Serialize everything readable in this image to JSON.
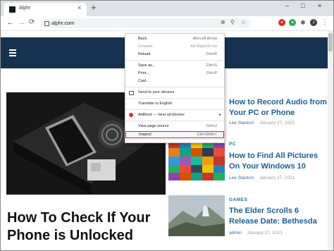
{
  "browser": {
    "tab_title": "Alphr",
    "tab_close": "×",
    "new_tab": "+",
    "url": "alphr.com",
    "back_glyph": "←",
    "forward_glyph": "→",
    "reload_glyph": "C",
    "window_buttons": [
      "–",
      "□",
      "×"
    ]
  },
  "context_menu": {
    "items": [
      {
        "label": "Back",
        "shortcut": "Alt+Left Arrow"
      },
      {
        "label": "Forward",
        "shortcut": "Alt+Right Arrow",
        "disabled": true
      },
      {
        "label": "Reload",
        "shortcut": "Ctrl+R"
      },
      {
        "label": "Save as...",
        "shortcut": "Ctrl+S"
      },
      {
        "label": "Print...",
        "shortcut": "Ctrl+P"
      },
      {
        "label": "Cast...",
        "shortcut": ""
      },
      {
        "label": "Send to your devices",
        "shortcut": ""
      },
      {
        "label": "Translate to English",
        "shortcut": ""
      },
      {
        "label": "AdBlock — best ad blocker",
        "shortcut": ""
      },
      {
        "label": "View page source",
        "shortcut": "Ctrl+U"
      },
      {
        "label": "Inspect",
        "shortcut": "Ctrl+Shift+I"
      }
    ]
  },
  "page": {
    "featured_title": "How To Check If Your Phone is Unlocked",
    "articles": [
      {
        "category": "",
        "title": "How to Record Audio from Your PC or Phone",
        "author": "Lee Stanton",
        "date": "January 27, 2021"
      },
      {
        "category": "PC",
        "title": "How to Find All Pictures On Your Windows 10",
        "author": "Lee Stanton",
        "date": "January 27, 2021"
      },
      {
        "category": "GAMES",
        "title": "The Elder Scrolls 6 Release Date: Bethesda",
        "author": "admin",
        "date": "January 27, 2021"
      }
    ]
  },
  "colors": {
    "site_header": "#17324f",
    "highlight_border": "#e02020",
    "link_blue": "#1b5f96"
  }
}
